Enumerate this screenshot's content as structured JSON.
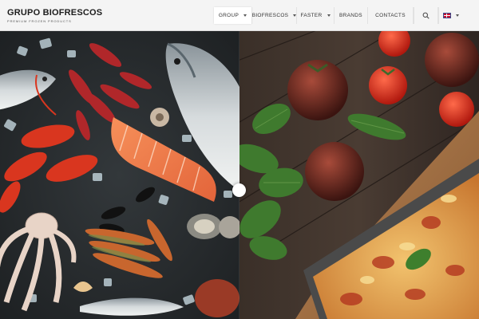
{
  "brand": {
    "name": "GRUPO BIOFRESCOS",
    "tagline": "PREMIUM FROZEN PRODUCTS"
  },
  "nav": {
    "items": [
      {
        "label": "GROUP",
        "has_dropdown": true,
        "active": true
      },
      {
        "label": "BIOFRESCOS",
        "has_dropdown": true,
        "active": false
      },
      {
        "label": "FASTER",
        "has_dropdown": true,
        "active": false
      },
      {
        "label": "BRANDS",
        "has_dropdown": false,
        "active": false
      },
      {
        "label": "CONTACTS",
        "has_dropdown": false,
        "active": false
      }
    ],
    "search_icon": "search-icon",
    "language_flag": "uk-flag-icon"
  },
  "hero": {
    "left_image": "seafood-on-slate",
    "right_image": "lasagna-with-tomatoes",
    "slider_handle_icon": "circle-handle"
  },
  "colors": {
    "header_bg": "#f4f4f4",
    "text_dark": "#1d1d1d",
    "active_tab_bg": "#ffffff"
  }
}
